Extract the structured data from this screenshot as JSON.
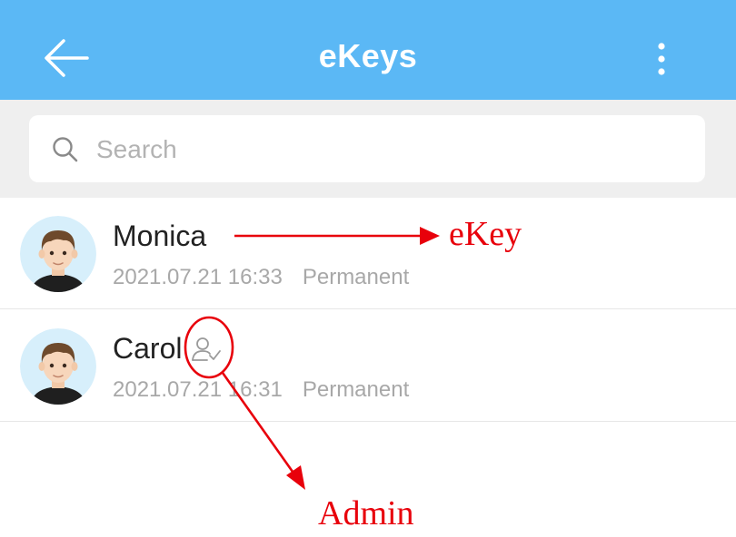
{
  "header": {
    "title": "eKeys",
    "back_icon": "arrow-left-icon",
    "menu_icon": "more-vertical-icon"
  },
  "search": {
    "placeholder": "Search",
    "icon": "search-icon"
  },
  "ekeys": [
    {
      "name": "Monica",
      "datetime": "2021.07.21 16:33",
      "type": "Permanent",
      "is_admin": false
    },
    {
      "name": "Carol",
      "datetime": "2021.07.21 16:31",
      "type": "Permanent",
      "is_admin": true
    }
  ],
  "annotations": {
    "ekey_label": "eKey",
    "admin_label": "Admin",
    "color": "#e8000b"
  },
  "colors": {
    "appbar": "#5bb8f5",
    "search_background": "#efefef",
    "avatar_background": "#d7effb"
  }
}
